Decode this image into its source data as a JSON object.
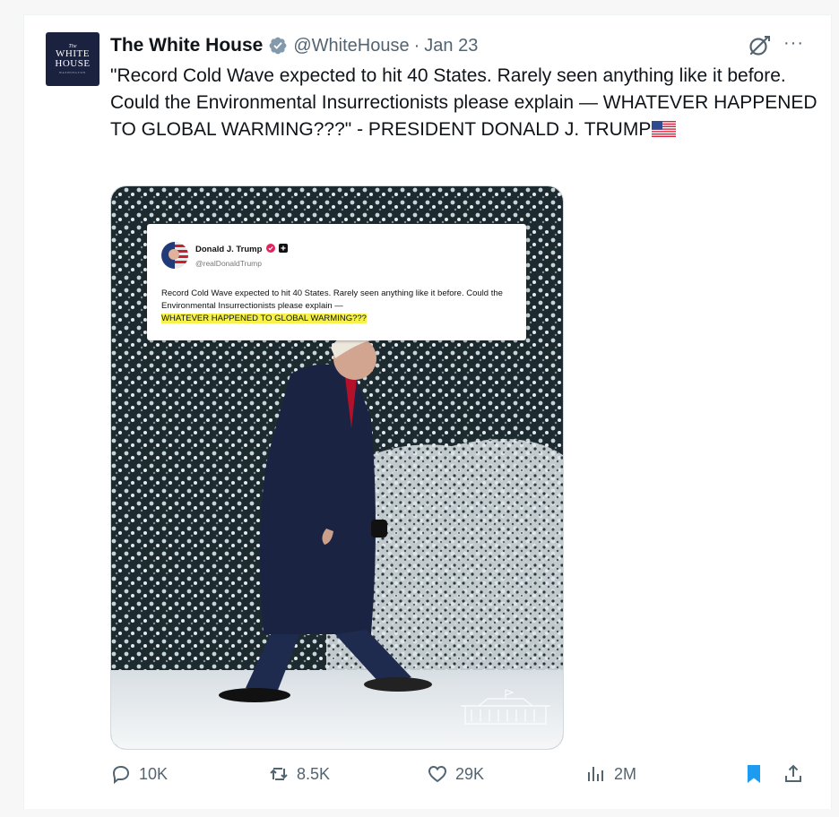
{
  "avatar": {
    "line1": "The",
    "line2": "WHITE",
    "line3": "HOUSE",
    "line4": "WASHINGTON"
  },
  "account": {
    "name": "The White House",
    "handle": "@WhiteHouse",
    "separator": "·",
    "date": "Jan 23"
  },
  "icons": {
    "verified": "verified-badge-icon",
    "grok": "grok-icon",
    "more": "more-icon",
    "flag": "us-flag-emoji",
    "reply": "reply-icon",
    "retweet": "retweet-icon",
    "like": "like-icon",
    "views": "views-icon",
    "bookmark": "bookmark-icon",
    "share": "share-icon"
  },
  "tweet": {
    "text": "\"Record Cold Wave expected to hit 40 States. Rarely seen anything like it before. Could the Environmental Insurrectionists please explain — WHATEVER HAPPENED TO GLOBAL WARMING???\" - PRESIDENT DONALD J. TRUMP"
  },
  "more_label": "···",
  "media": {
    "inner_tweet": {
      "name": "Donald J. Trump",
      "handle": "@realDonaldTrump",
      "text": "Record Cold Wave expected to hit 40 States. Rarely seen anything like it before. Could the Environmental Insurrectionists please explain —",
      "highlight": "WHATEVER HAPPENED TO GLOBAL WARMING???"
    }
  },
  "actions": {
    "replies": "10K",
    "retweets": "8.5K",
    "likes": "29K",
    "views": "2M"
  },
  "colors": {
    "accent": "#1d9bf0",
    "muted": "#536471",
    "highlight": "#f6f24a",
    "bookmark": "#1d9bf0"
  }
}
